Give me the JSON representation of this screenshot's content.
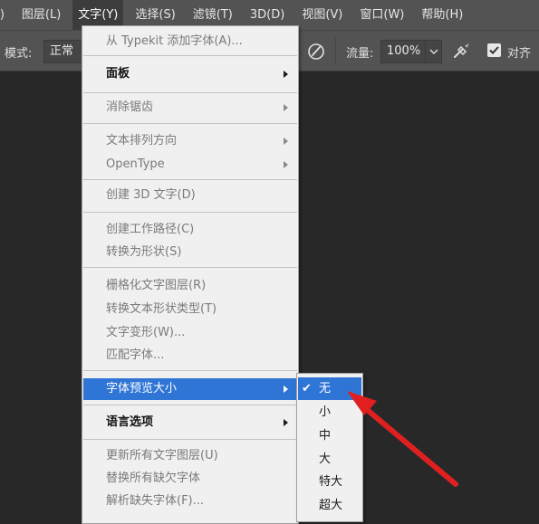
{
  "menubar": {
    "items": [
      {
        "label": "I)"
      },
      {
        "label": "图层(L)"
      },
      {
        "label": "文字(Y)"
      },
      {
        "label": "选择(S)"
      },
      {
        "label": "滤镜(T)"
      },
      {
        "label": "3D(D)"
      },
      {
        "label": "视图(V)"
      },
      {
        "label": "窗口(W)"
      },
      {
        "label": "帮助(H)"
      }
    ]
  },
  "options": {
    "mode_label": "模式:",
    "mode_value": "正常",
    "flow_label": "流量:",
    "flow_value": "100%",
    "align_label": "对齐"
  },
  "type_menu": {
    "items": {
      "typekit": "从 Typekit 添加字体(A)...",
      "panels": "面板",
      "anti_alias": "消除锯齿",
      "orientation": "文本排列方向",
      "opentype": "OpenType",
      "create_3d": "创建 3D 文字(D)",
      "create_work_path": "创建工作路径(C)",
      "convert_to_shape": "转换为形状(S)",
      "rasterize": "栅格化文字图层(R)",
      "convert_text_shape_type": "转换文本形状类型(T)",
      "warp_text": "文字变形(W)...",
      "match_font": "匹配字体...",
      "font_preview_size": "字体预览大小",
      "language_options": "语言选项",
      "update_all": "更新所有文字图层(U)",
      "replace_missing": "替换所有缺欠字体",
      "resolve_missing": "解析缺失字体(F)..."
    }
  },
  "preview_size_submenu": {
    "check_mark": "✔",
    "items": [
      "无",
      "小",
      "中",
      "大",
      "特大",
      "超大"
    ],
    "selected": "无"
  },
  "colors": {
    "highlight": "#2f75d6",
    "annotation_arrow": "#e02020"
  }
}
